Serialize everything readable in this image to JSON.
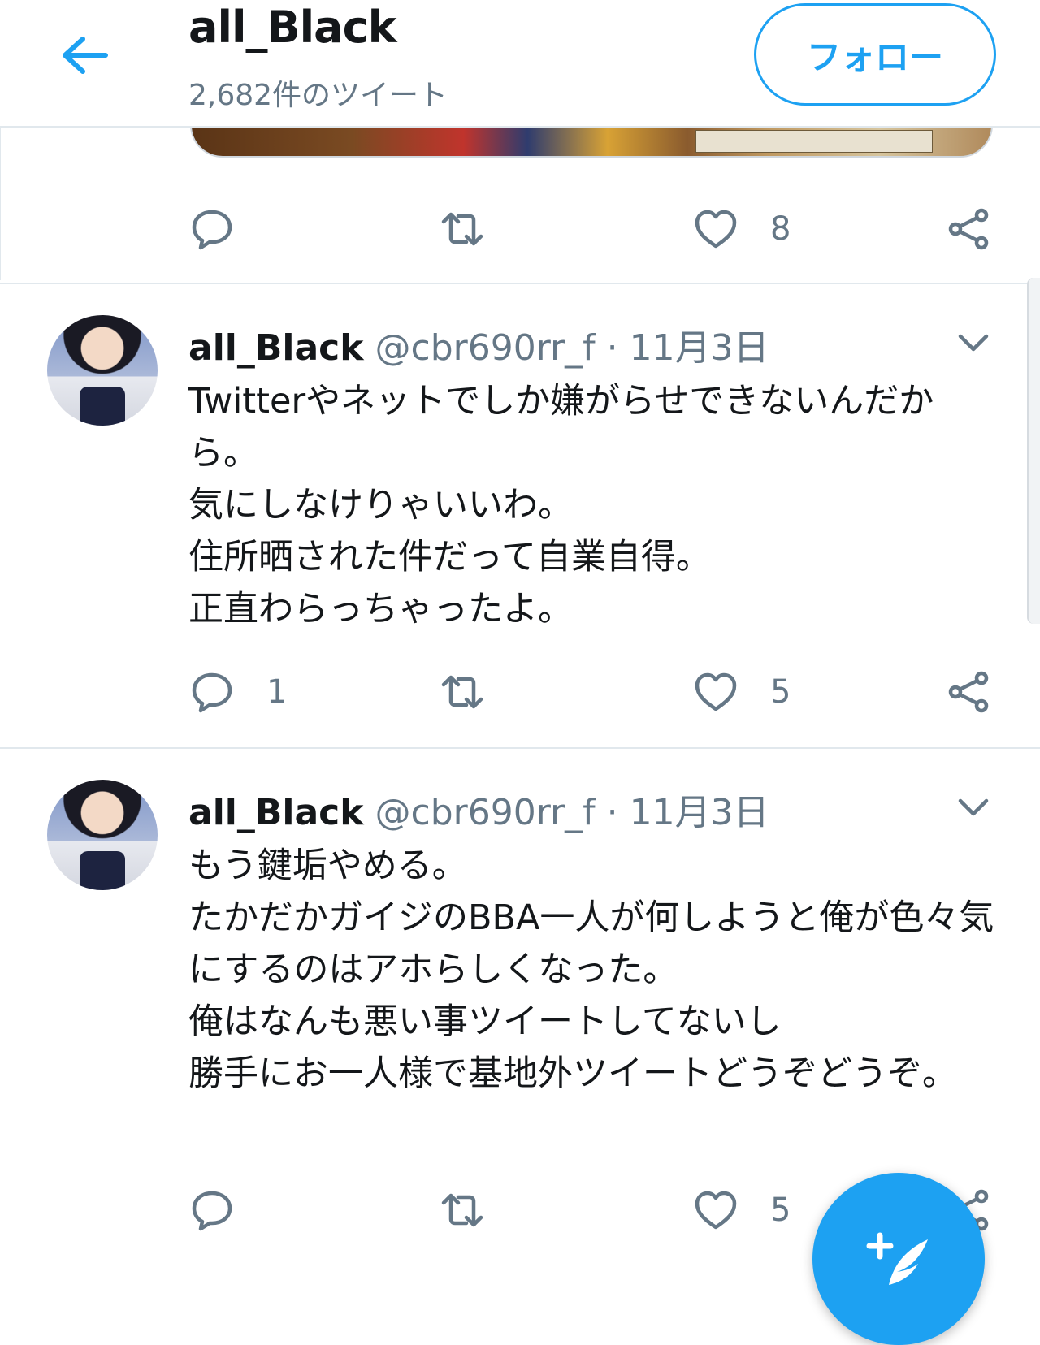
{
  "header": {
    "title": "all_Black",
    "tweet_count": "2,682件のツイート",
    "follow_label": "フォロー"
  },
  "tweets": [
    {
      "actions": {
        "reply_count": "",
        "retweet_count": "",
        "like_count": "8"
      }
    },
    {
      "name": "all_Black",
      "handle": "@cbr690rr_f",
      "separator": "·",
      "date": "11月3日",
      "text": "Twitterやネットでしか嫌がらせできないんだから。\n気にしなけりゃいいわ。\n住所晒された件だって自業自得。\n正直わらっちゃったよ。",
      "actions": {
        "reply_count": "1",
        "retweet_count": "",
        "like_count": "5"
      }
    },
    {
      "name": "all_Black",
      "handle": "@cbr690rr_f",
      "separator": "·",
      "date": "11月3日",
      "text": "もう鍵垢やめる。\nたかだかガイジのBBA一人が何しようと俺が色々気にするのはアホらしくなった。\n俺はなんも悪い事ツイートしてないし\n勝手にお一人様で基地外ツイートどうぞどうぞ。",
      "actions": {
        "reply_count": "",
        "retweet_count": "",
        "like_count": "5"
      }
    }
  ],
  "colors": {
    "accent": "#1da1f2",
    "secondary_text": "#657786",
    "divider": "#e1e8ed"
  },
  "icons": [
    "back-arrow-icon",
    "reply-icon",
    "retweet-icon",
    "like-icon",
    "share-icon",
    "chevron-down-icon",
    "compose-tweet-icon"
  ]
}
